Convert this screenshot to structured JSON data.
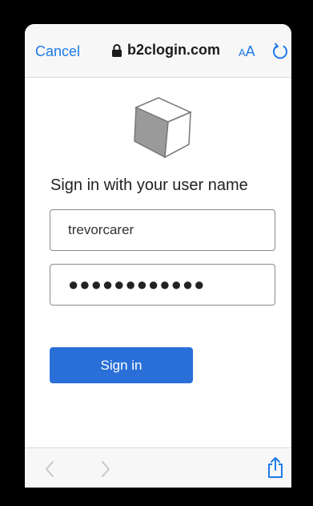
{
  "browser": {
    "cancel_label": "Cancel",
    "host": "b2clogin.com",
    "text_size_small": "A",
    "text_size_big": "A",
    "icons": [
      "lock-icon",
      "text-size-icon",
      "reload-icon",
      "back-icon",
      "forward-icon",
      "share-icon"
    ],
    "accent_color": "#1f7ae8"
  },
  "page": {
    "logo_icon": "cube-logo-icon",
    "title": "Sign in with your user name",
    "username_value": "trevorcarer",
    "password_mask": "●●●●●●●●●●●●",
    "signin_label": "Sign in",
    "button_color": "#2a6fd8"
  }
}
